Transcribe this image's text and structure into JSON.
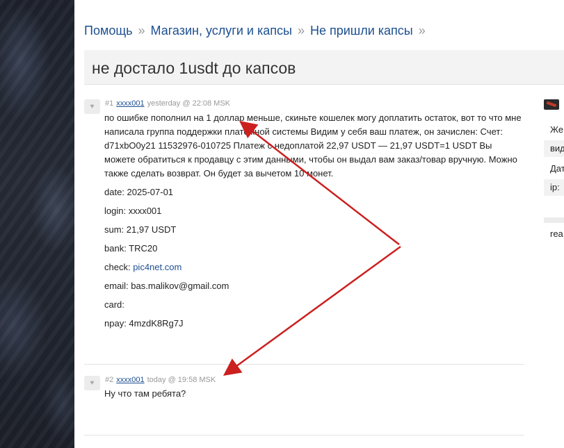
{
  "breadcrumb": {
    "items": [
      "Помощь",
      "Магазин, услуги и капсы",
      "Не пришли капсы"
    ],
    "separator": "»"
  },
  "thread": {
    "title": "не достало 1usdt до капсов"
  },
  "posts": [
    {
      "number": "#1",
      "author": "xxxx001",
      "time": "yesterday @ 22:08 MSK",
      "text": "по ошибке пополнил на 1 доллар меньше, скиньте кошелек могу доплатить остаток, вот то что мне написала группа поддержки платежной системы Видим у себя ваш платеж, он зачислен: Счет: d71xbO0y21 11532976-010725 Платеж с недоплатой 22,97 USDT — 21,97 USDT=1 USDT Вы можете обратиться к продавцу с этим данными, чтобы он выдал вам заказ/товар вручную. Можно также сделать возврат. Он будет за вычетом 10 монет.",
      "fields": {
        "date": "date: 2025-07-01",
        "login": "login: xxxx001",
        "sum": "sum: 21,97 USDT",
        "bank": "bank: TRC20",
        "check_label": "check:",
        "check_link": "pic4net.com",
        "email": "email: bas.malikov@gmail.com",
        "card": "card:",
        "npay": "npay: 4mzdK8Rg7J"
      }
    },
    {
      "number": "#2",
      "author": "xxxx001",
      "time": "today @ 19:58 MSK",
      "text": "Ну что там ребята?"
    }
  ],
  "sidebar": {
    "rows": [
      "Же",
      "вид",
      "Дат",
      "ip:",
      "rea"
    ]
  },
  "colors": {
    "link": "#1d4f91",
    "annotation_arrow": "#cc1f1f"
  },
  "icons": {
    "avatar": "avatar-placeholder-icon",
    "sidebar_badge": "user-badge-icon"
  }
}
